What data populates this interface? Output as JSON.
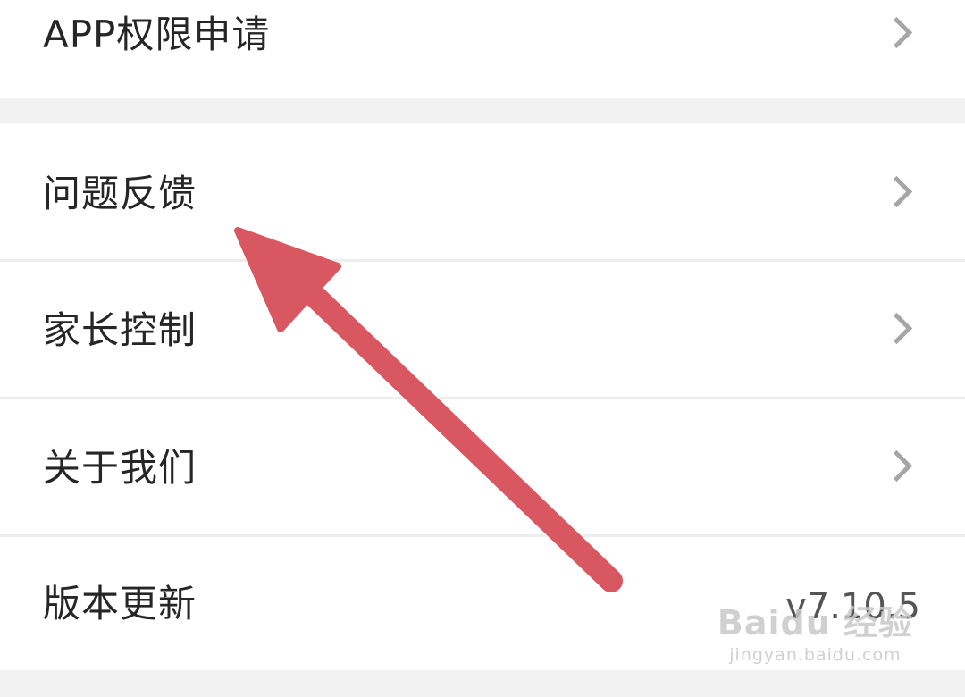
{
  "menu": {
    "items": [
      {
        "label": "APP权限申请"
      },
      {
        "label": "问题反馈"
      },
      {
        "label": "家长控制"
      },
      {
        "label": "关于我们"
      },
      {
        "label": "版本更新",
        "value": "v7.10.5"
      }
    ]
  },
  "annotation": {
    "arrow_color": "#d95761",
    "points_to": "问题反馈"
  },
  "watermark": {
    "logo": "Baidu 经验",
    "url": "jingyan.baidu.com"
  },
  "icons": {
    "chevron": "chevron-right-icon",
    "arrow": "arrow-up-left-icon"
  }
}
